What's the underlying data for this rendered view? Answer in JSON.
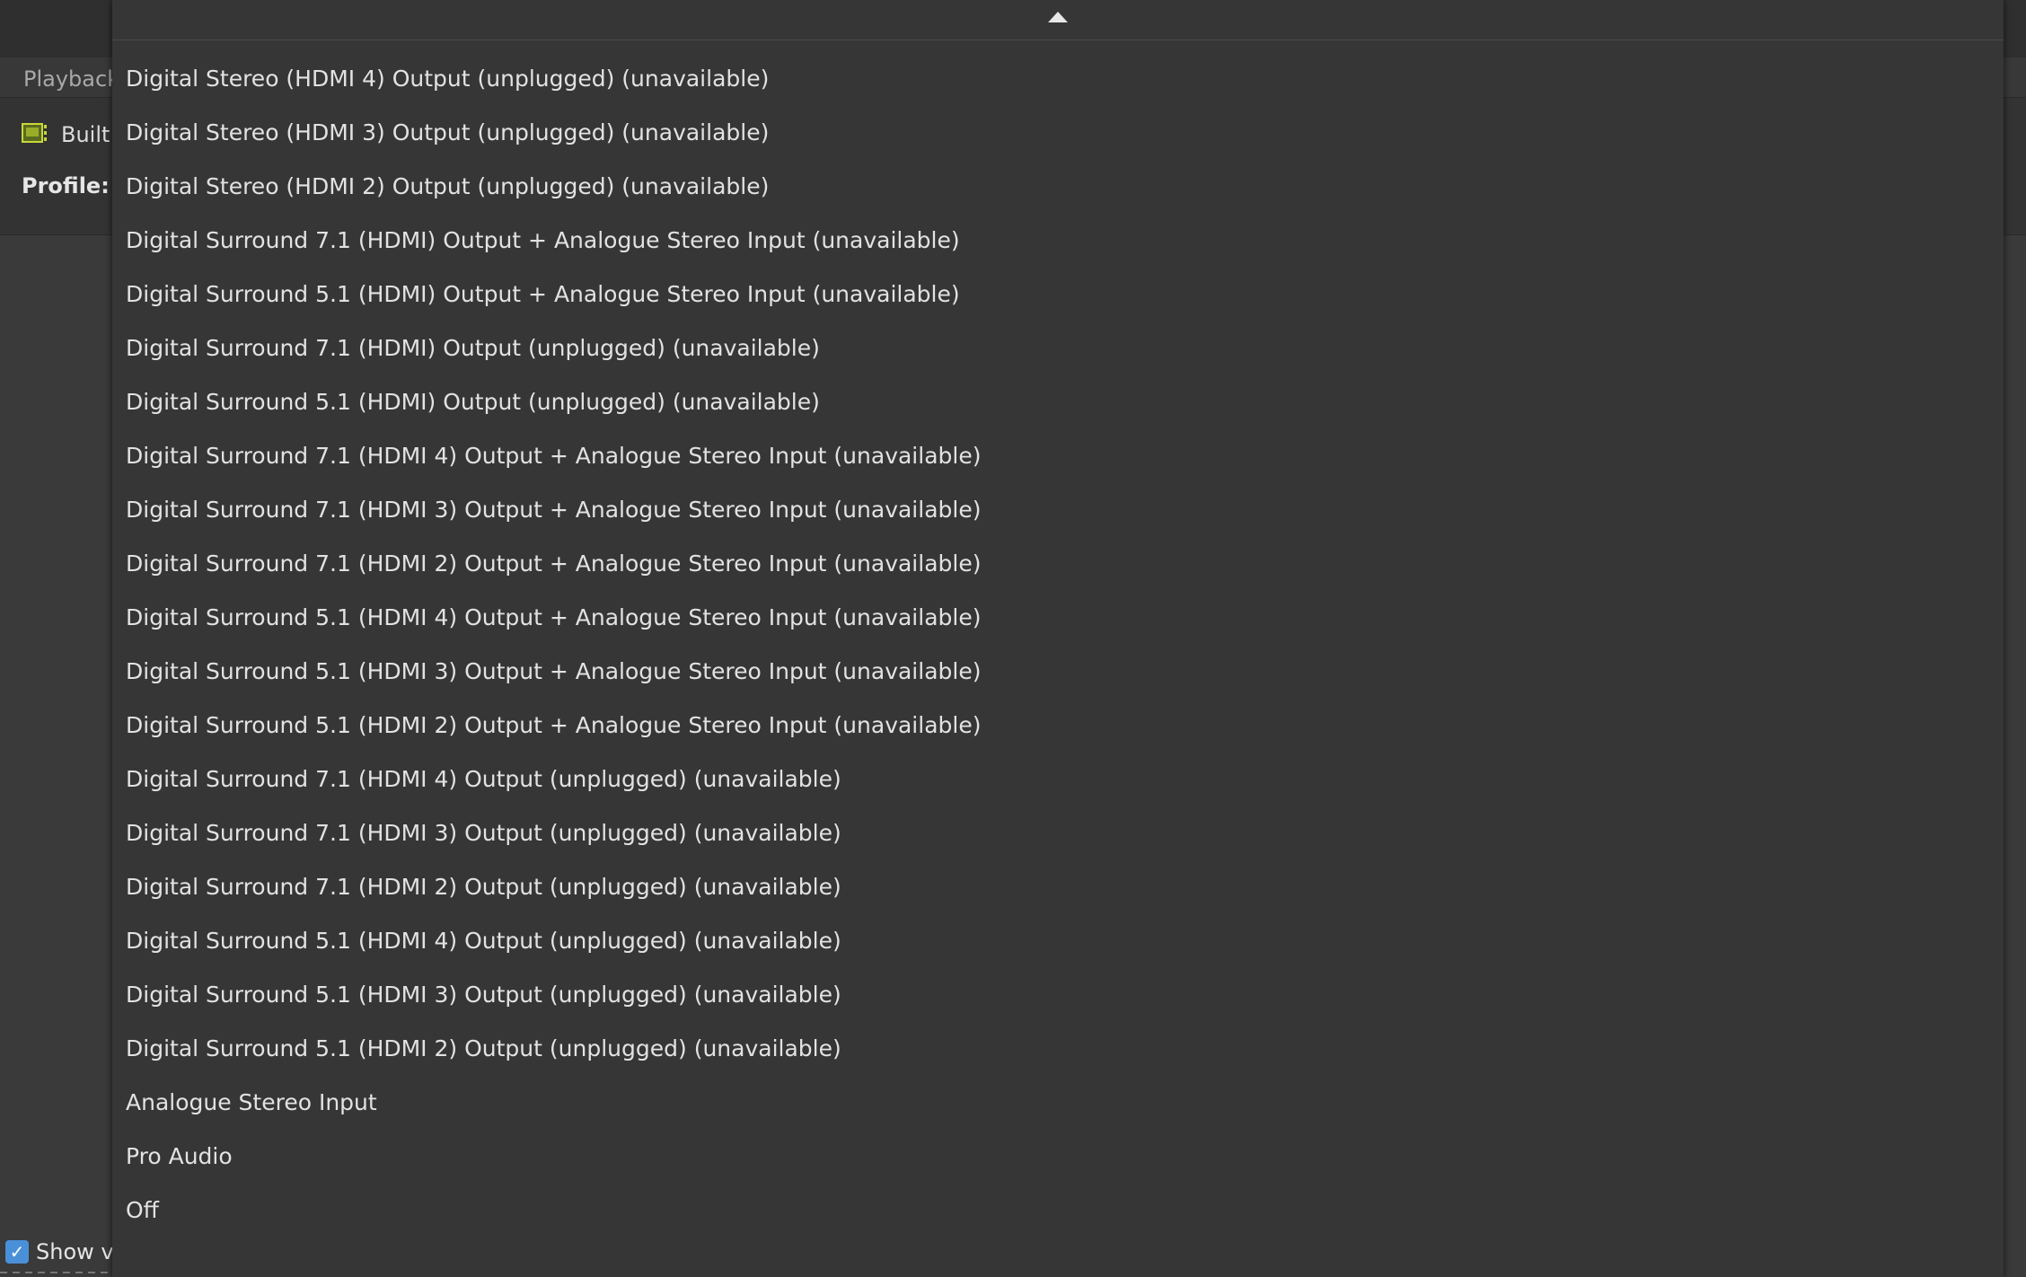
{
  "background_window": {
    "tab_label": "Playback",
    "card_name": "Built",
    "profile_label": "Profile:",
    "show_checkbox_label": "Show v",
    "card_icon": "sound-card-icon"
  },
  "dropdown": {
    "scroll_up_icon": "scroll-up-arrow-icon",
    "items": [
      {
        "label": "Digital Stereo (HDMI 4) Output (unplugged) (unavailable)"
      },
      {
        "label": "Digital Stereo (HDMI 3) Output (unplugged) (unavailable)"
      },
      {
        "label": "Digital Stereo (HDMI 2) Output (unplugged) (unavailable)"
      },
      {
        "label": "Digital Surround 7.1 (HDMI) Output + Analogue Stereo Input (unavailable)"
      },
      {
        "label": "Digital Surround 5.1 (HDMI) Output + Analogue Stereo Input (unavailable)"
      },
      {
        "label": "Digital Surround 7.1 (HDMI) Output (unplugged) (unavailable)"
      },
      {
        "label": "Digital Surround 5.1 (HDMI) Output (unplugged) (unavailable)"
      },
      {
        "label": "Digital Surround 7.1 (HDMI 4) Output + Analogue Stereo Input (unavailable)"
      },
      {
        "label": "Digital Surround 7.1 (HDMI 3) Output + Analogue Stereo Input (unavailable)"
      },
      {
        "label": "Digital Surround 7.1 (HDMI 2) Output + Analogue Stereo Input (unavailable)"
      },
      {
        "label": "Digital Surround 5.1 (HDMI 4) Output + Analogue Stereo Input (unavailable)"
      },
      {
        "label": "Digital Surround 5.1 (HDMI 3) Output + Analogue Stereo Input (unavailable)"
      },
      {
        "label": "Digital Surround 5.1 (HDMI 2) Output + Analogue Stereo Input (unavailable)"
      },
      {
        "label": "Digital Surround 7.1 (HDMI 4) Output (unplugged) (unavailable)"
      },
      {
        "label": "Digital Surround 7.1 (HDMI 3) Output (unplugged) (unavailable)"
      },
      {
        "label": "Digital Surround 7.1 (HDMI 2) Output (unplugged) (unavailable)"
      },
      {
        "label": "Digital Surround 5.1 (HDMI 4) Output (unplugged) (unavailable)"
      },
      {
        "label": "Digital Surround 5.1 (HDMI 3) Output (unplugged) (unavailable)"
      },
      {
        "label": "Digital Surround 5.1 (HDMI 2) Output (unplugged) (unavailable)"
      },
      {
        "label": "Analogue Stereo Input"
      },
      {
        "label": "Pro Audio"
      },
      {
        "label": "Off"
      }
    ]
  }
}
